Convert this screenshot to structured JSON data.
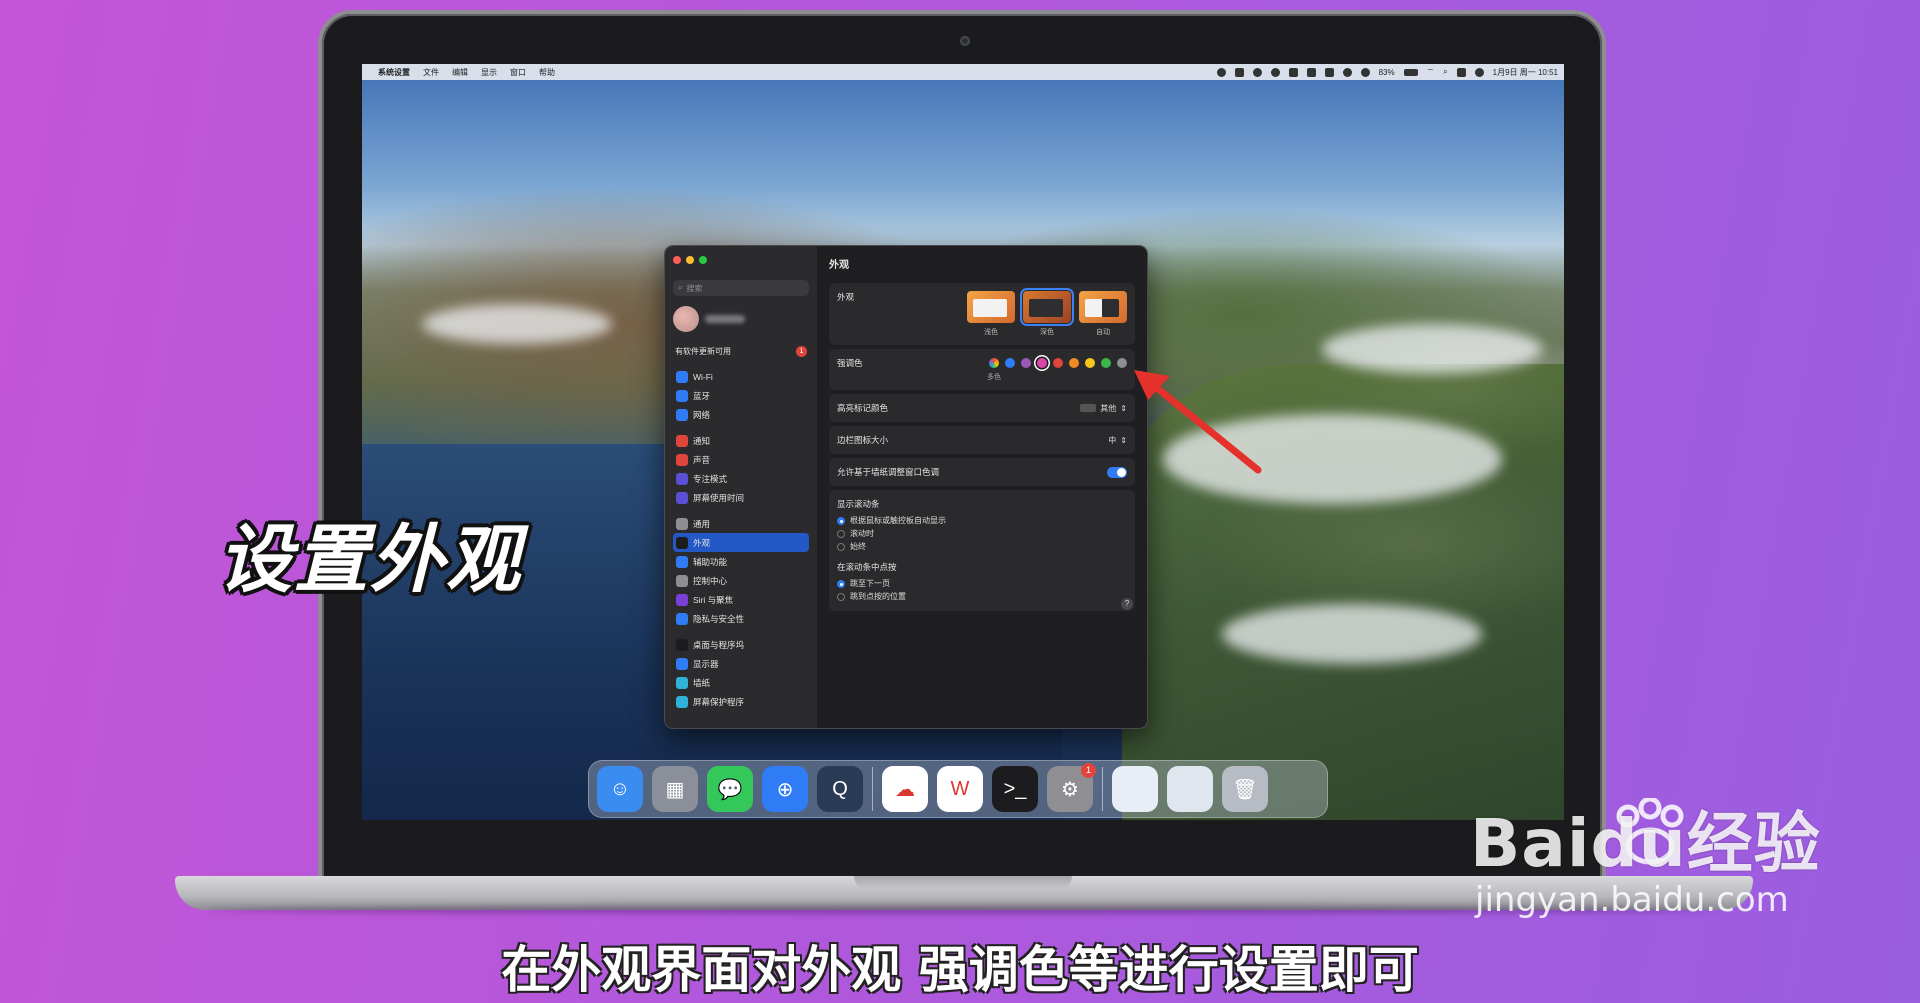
{
  "menubar": {
    "apple": "",
    "items": [
      "系统设置",
      "文件",
      "编辑",
      "显示",
      "窗口",
      "帮助"
    ],
    "battery": "83%",
    "datetime": "1月9日 周一  10:51"
  },
  "sidebar": {
    "search_placeholder": "搜索",
    "update_label": "有软件更新可用",
    "update_badge": "1",
    "groups": [
      [
        {
          "label": "Wi-Fi",
          "icon": "wifi-icon",
          "color": "#2f7cf6"
        },
        {
          "label": "蓝牙",
          "icon": "bluetooth-icon",
          "color": "#2f7cf6"
        },
        {
          "label": "网络",
          "icon": "globe-icon",
          "color": "#2f7cf6"
        }
      ],
      [
        {
          "label": "通知",
          "icon": "bell-icon",
          "color": "#e0443b"
        },
        {
          "label": "声音",
          "icon": "speaker-icon",
          "color": "#e0443b"
        },
        {
          "label": "专注模式",
          "icon": "moon-icon",
          "color": "#5b4fd6"
        },
        {
          "label": "屏幕使用时间",
          "icon": "hourglass-icon",
          "color": "#5b4fd6"
        }
      ],
      [
        {
          "label": "通用",
          "icon": "gear-icon",
          "color": "#8e8e93"
        },
        {
          "label": "外观",
          "icon": "appearance-icon",
          "color": "#1c1c1e",
          "active": true
        },
        {
          "label": "辅助功能",
          "icon": "accessibility-icon",
          "color": "#2f7cf6"
        },
        {
          "label": "控制中心",
          "icon": "control-center-icon",
          "color": "#8e8e93"
        },
        {
          "label": "Siri 与聚焦",
          "icon": "siri-icon",
          "color": "#7a3fd4"
        },
        {
          "label": "隐私与安全性",
          "icon": "hand-icon",
          "color": "#2f7cf6"
        }
      ],
      [
        {
          "label": "桌面与程序坞",
          "icon": "dock-icon",
          "color": "#1c1c1e"
        },
        {
          "label": "显示器",
          "icon": "sun-icon",
          "color": "#2f7cf6"
        },
        {
          "label": "墙纸",
          "icon": "wallpaper-icon",
          "color": "#2fb3d8"
        },
        {
          "label": "屏幕保护程序",
          "icon": "screensaver-icon",
          "color": "#2fb3d8"
        }
      ]
    ]
  },
  "main": {
    "title": "外观",
    "appearance": {
      "label": "外观",
      "options": [
        {
          "label": "浅色",
          "variant": "light"
        },
        {
          "label": "深色",
          "variant": "dark",
          "selected": true
        },
        {
          "label": "自动",
          "variant": "auto"
        }
      ]
    },
    "accent": {
      "label": "强调色",
      "selected_label": "多色",
      "colors": [
        "multi",
        "#2f7cf6",
        "#9b59b6",
        "#d946a8",
        "#e0443b",
        "#f08a24",
        "#f5c518",
        "#3bb54a",
        "#8e8e93"
      ],
      "selected_index": 3
    },
    "highlight": {
      "label": "高亮标记颜色",
      "value": "其他"
    },
    "sidebar_icon_size": {
      "label": "边栏图标大小",
      "value": "中"
    },
    "wallpaper_tint": {
      "label": "允许基于墙纸调整窗口色调",
      "on": true
    },
    "scrollbars": {
      "label": "显示滚动条",
      "options": [
        "根据鼠标或触控板自动显示",
        "滚动时",
        "始终"
      ],
      "selected": 0
    },
    "scroll_click": {
      "label": "在滚动条中点按",
      "options": [
        "跳至下一页",
        "跳到点按的位置"
      ],
      "selected": 0
    },
    "help": "?"
  },
  "dock": {
    "apps": [
      {
        "name": "finder-icon",
        "color": "#3b8cf0",
        "glyph": "☺"
      },
      {
        "name": "launchpad-icon",
        "color": "#8a8f99",
        "glyph": "▦"
      },
      {
        "name": "messages-icon",
        "color": "#34c759",
        "glyph": "💬"
      },
      {
        "name": "safari-icon",
        "color": "#2f7cf6",
        "glyph": "⊕"
      },
      {
        "name": "quicktime-icon",
        "color": "#2a3b55",
        "glyph": "Q"
      },
      {
        "name": "baidu-netdisk-icon",
        "color": "#ffffff",
        "glyph": "☁"
      },
      {
        "name": "wps-icon",
        "color": "#ffffff",
        "glyph": "W"
      },
      {
        "name": "terminal-icon",
        "color": "#1c1c1e",
        "glyph": ">_"
      },
      {
        "name": "system-settings-icon",
        "color": "#8e8e93",
        "glyph": "⚙",
        "badge": "1"
      },
      {
        "name": "recent-window-1-icon",
        "color": "#e8eef5",
        "glyph": ""
      },
      {
        "name": "recent-window-2-icon",
        "color": "#dfe6ee",
        "glyph": ""
      },
      {
        "name": "trash-icon",
        "color": "#b7bcc4",
        "glyph": "🗑"
      }
    ]
  },
  "overlay": {
    "title": "设置外观",
    "subtitle": "在外观界面对外观 强调色等进行设置即可"
  },
  "watermark": {
    "logo": "Baidu经验",
    "url": "jingyan.baidu.com"
  }
}
